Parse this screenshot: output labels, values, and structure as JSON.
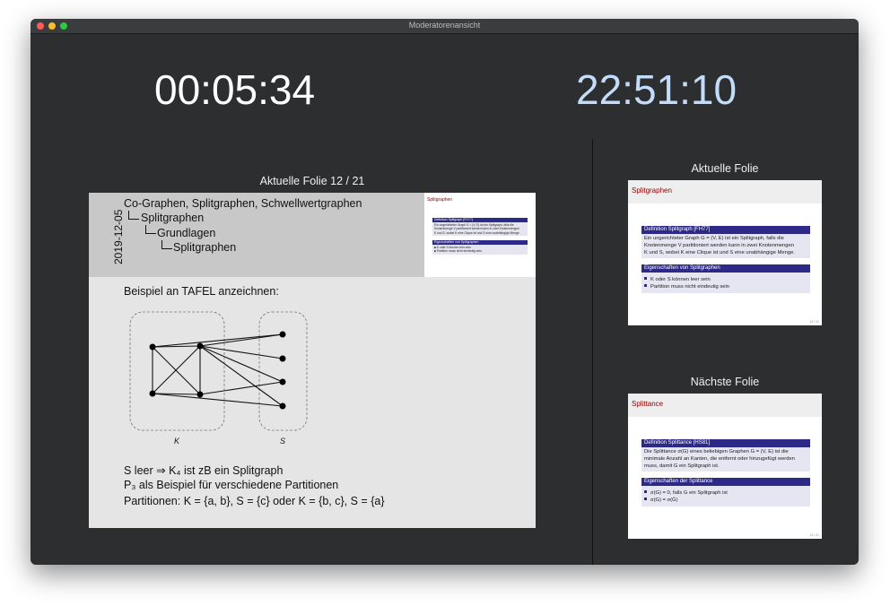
{
  "window": {
    "title": "Moderatorenansicht"
  },
  "timers": {
    "elapsed": "00:05:34",
    "clock": "22:51:10"
  },
  "current_slide_label": "Aktuelle Folie 12 / 21",
  "main_slide": {
    "date": "2019-12-05",
    "tree": [
      "Co-Graphen, Splitgraphen, Schwellwertgraphen",
      "Splitgraphen",
      "Grundlagen",
      "Splitgraphen"
    ],
    "thumbnail": {
      "title": "Splitgraphen",
      "block1_title": "Definition Splitgraph [FH77]",
      "block1_lines": [
        "Ein ungerichteter Graph G = (V, E) ist ein Splitgraph, falls die",
        "Knotenmenge V partitioniert werden kann in zwei Knotenmengen",
        "K und S, wobei K eine Clique ist und S eine unabhängige Menge."
      ],
      "block2_title": "Eigenschaften von Splitgraphen",
      "block2_items": [
        "■ K oder S können leer sein",
        "■ Partition muss nicht eindeutig sein"
      ]
    },
    "heading": "Beispiel an TAFEL anzeichnen:",
    "graph_labels": {
      "k": "K",
      "s": "S"
    },
    "line1": "S leer ⇒ K₄ ist zB ein Splitgraph",
    "line2": "P₃ als Beispiel für verschiedene Partitionen",
    "line3": "Partitionen: K = {a, b}, S = {c} oder K = {b, c}, S = {a}"
  },
  "right_panel": {
    "current_label": "Aktuelle Folie",
    "next_label": "Nächste Folie",
    "current_slide": {
      "title": "Splitgraphen",
      "block1_title": "Definition Splitgraph [FH77]",
      "block1_lines": [
        "Ein ungerichteter Graph G = (V, E) ist ein Splitgraph, falls die",
        "Knotenmenge V partitioniert werden kann in zwei Knotenmengen",
        "K und S, wobei K eine Clique ist und S eine unabhängige Menge."
      ],
      "block2_title": "Eigenschaften von Splitgraphen",
      "block2_items": [
        "K oder S können leer sein",
        "Partition muss nicht eindeutig sein"
      ],
      "page": "12 / 21"
    },
    "next_slide": {
      "title": "Splittance",
      "block1_title": "Definition Splittance [HS81]",
      "block1_lines": [
        "Die Splittance σ(G) eines beliebigen Graphen G = (V, E) ist die",
        "minimale Anzahl an Kanten, die entfernt oder hinzugefügt werden",
        "muss, damit G ein Splitgraph ist."
      ],
      "block2_title": "Eigenschaften der Splittance",
      "block2_items": [
        "σ(G) = 0, falls G ein Splitgraph ist",
        "σ(G) = σ(Ḡ)"
      ],
      "page": "13 / 21"
    }
  },
  "colors": {
    "window_bg": "#2d2e30",
    "clock": "#c2dcf9",
    "block_header": "#2d2a87",
    "slide_title": "#8b0000"
  }
}
